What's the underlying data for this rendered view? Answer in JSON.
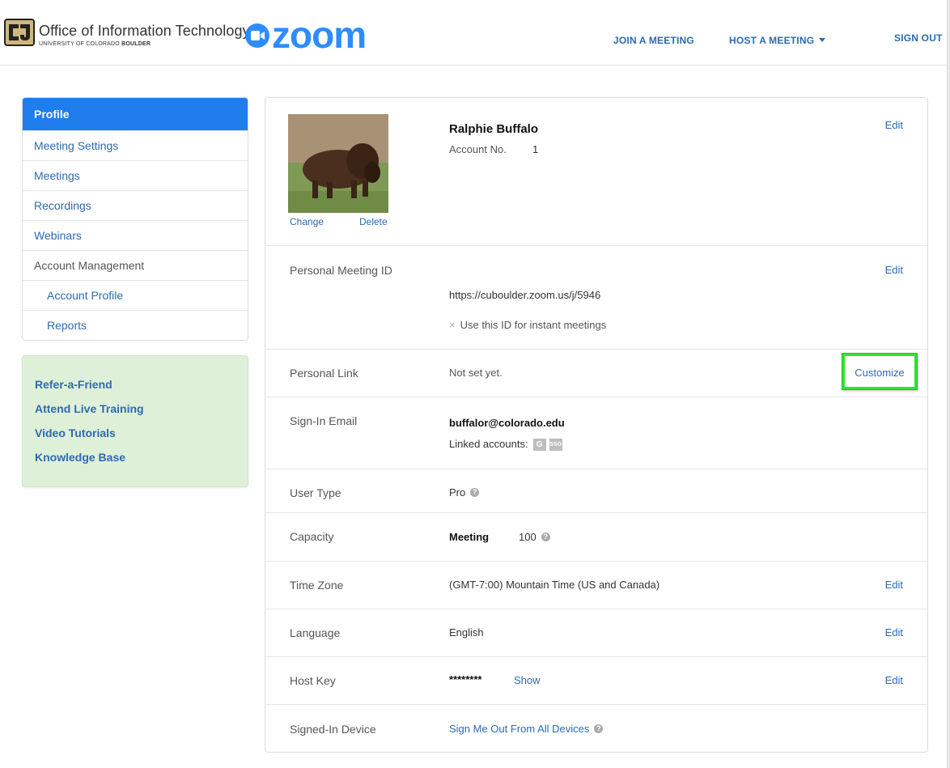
{
  "header": {
    "oit_title": "Office of Information Technology",
    "oit_sub_regular": "UNIVERSITY OF COLORADO ",
    "oit_sub_bold": "BOULDER",
    "zoom_brand": "zoom",
    "nav": {
      "join": "JOIN A MEETING",
      "host": "HOST A MEETING",
      "signout": "SIGN OUT"
    }
  },
  "sidebar": {
    "items": [
      {
        "label": "Profile"
      },
      {
        "label": "Meeting Settings"
      },
      {
        "label": "Meetings"
      },
      {
        "label": "Recordings"
      },
      {
        "label": "Webinars"
      },
      {
        "label": "Account Management"
      },
      {
        "label": "Account Profile"
      },
      {
        "label": "Reports"
      }
    ],
    "promo": [
      {
        "label": "Refer-a-Friend"
      },
      {
        "label": "Attend Live Training"
      },
      {
        "label": "Video Tutorials"
      },
      {
        "label": "Knowledge Base"
      }
    ]
  },
  "profile": {
    "name": "Ralphie Buffalo",
    "account_label": "Account No.",
    "account_number": "1",
    "change": "Change",
    "delete": "Delete",
    "edit": "Edit"
  },
  "pmi": {
    "label": "Personal Meeting ID",
    "url": "https://cuboulder.zoom.us/j/5946",
    "instant_mark": "×",
    "instant": "Use this ID for instant meetings",
    "edit": "Edit"
  },
  "personal_link": {
    "label": "Personal Link",
    "value": "Not set yet.",
    "customize": "Customize"
  },
  "sign_in": {
    "label": "Sign-In Email",
    "email": "buffalor@colorado.edu",
    "linked_label": "Linked accounts:",
    "linked_google": "G",
    "linked_sso": "SSO"
  },
  "user_type": {
    "label": "User Type",
    "value": "Pro"
  },
  "capacity": {
    "label": "Capacity",
    "kind": "Meeting",
    "value": "100"
  },
  "time_zone": {
    "label": "Time Zone",
    "value": "(GMT-7:00) Mountain Time (US and Canada)",
    "edit": "Edit"
  },
  "language": {
    "label": "Language",
    "value": "English",
    "edit": "Edit"
  },
  "host_key": {
    "label": "Host Key",
    "value": "********",
    "show": "Show",
    "edit": "Edit"
  },
  "device": {
    "label": "Signed-In Device",
    "action": "Sign Me Out From All Devices"
  },
  "help_glyph": "?",
  "colors": {
    "link": "#2d6ab1",
    "active_nav": "#1f7ded",
    "promo_bg": "#dff0d8",
    "highlight": "#2ee62e"
  }
}
